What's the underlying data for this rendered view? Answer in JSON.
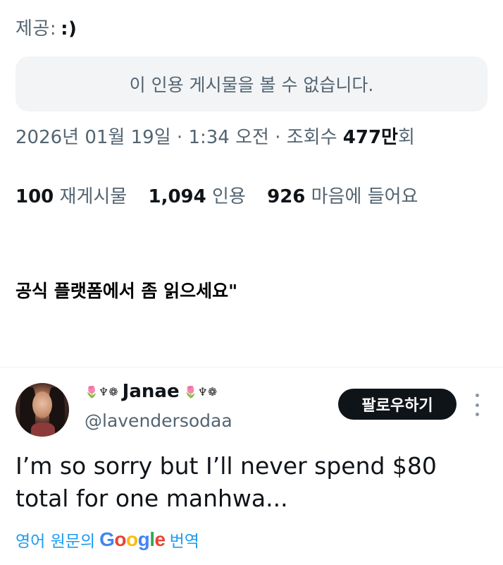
{
  "provided": {
    "label": "제공:",
    "emoticon": ":)"
  },
  "quote": {
    "unavailable_text": "이 인용 게시물을 볼 수 없습니다."
  },
  "meta": {
    "date": "2026년 01월 19일",
    "separator": " · ",
    "time": "1:34 오전",
    "views_label": "조회수",
    "views_number": "477만",
    "views_suffix": "회"
  },
  "stats": {
    "reposts_count": "100",
    "reposts_label": "재게시물",
    "quotes_count": "1,094",
    "quotes_label": "인용",
    "likes_count": "926",
    "likes_label": "마음에 들어요"
  },
  "caption": "공식 플랫폼에서 좀 읽으세요\"",
  "reply": {
    "emoji_left": "🌷♆❁",
    "emoji_right": "🌷♆❁",
    "display_name": "Janae",
    "handle": "@lavendersodaa",
    "follow_label": "팔로우하기",
    "text": "I’m so sorry but I’ll never spend $80 total for one manhwa...",
    "translate_prefix": "영어 원문의",
    "translate_suffix": "번역",
    "google_logo": "Google"
  },
  "icons": {
    "more": "more-vertical-icon",
    "avatar": "profile-avatar"
  },
  "colors": {
    "text_primary": "#0f1419",
    "text_secondary": "#536471",
    "link_blue": "#1d9bf0",
    "button_bg": "#0f1419",
    "quote_bg": "#f2f4f6"
  }
}
